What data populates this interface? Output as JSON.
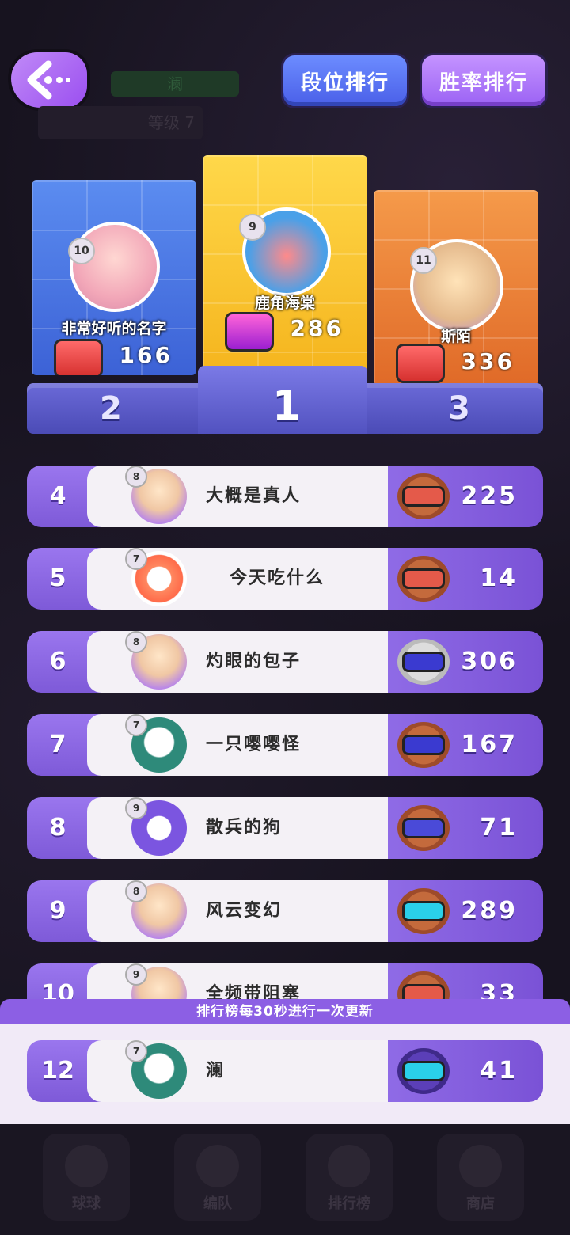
{
  "header": {
    "player_name_ghost": "澜",
    "level_ghost": "等级 7",
    "tabs": [
      {
        "label": "段位排行",
        "active": true
      },
      {
        "label": "胜率排行",
        "active": false
      }
    ]
  },
  "podium": [
    {
      "place": "2",
      "name": "非常好听的名字",
      "level": "10",
      "score": "166"
    },
    {
      "place": "1",
      "name": "鹿角海棠",
      "level": "9",
      "score": "286"
    },
    {
      "place": "3",
      "name": "斯陌",
      "level": "11",
      "score": "336"
    }
  ],
  "rows": [
    {
      "rank": "4",
      "level": "8",
      "name": "大概是真人",
      "score": "225"
    },
    {
      "rank": "5",
      "level": "7",
      "name": "今天吃什么",
      "score": "14"
    },
    {
      "rank": "6",
      "level": "8",
      "name": "灼眼的包子",
      "score": "306"
    },
    {
      "rank": "7",
      "level": "7",
      "name": "一只嘤嘤怪",
      "score": "167"
    },
    {
      "rank": "8",
      "level": "9",
      "name": "散兵的狗",
      "score": "71"
    },
    {
      "rank": "9",
      "level": "8",
      "name": "风云变幻",
      "score": "289"
    },
    {
      "rank": "10",
      "level": "9",
      "name": "全频带阻塞",
      "score": "33"
    }
  ],
  "notice": "排行榜每30秒进行一次更新",
  "me": {
    "rank": "12",
    "level": "7",
    "name": "澜",
    "score": "41"
  },
  "nav": [
    {
      "label": "球球"
    },
    {
      "label": "编队"
    },
    {
      "label": "排行榜"
    },
    {
      "label": "商店"
    }
  ]
}
